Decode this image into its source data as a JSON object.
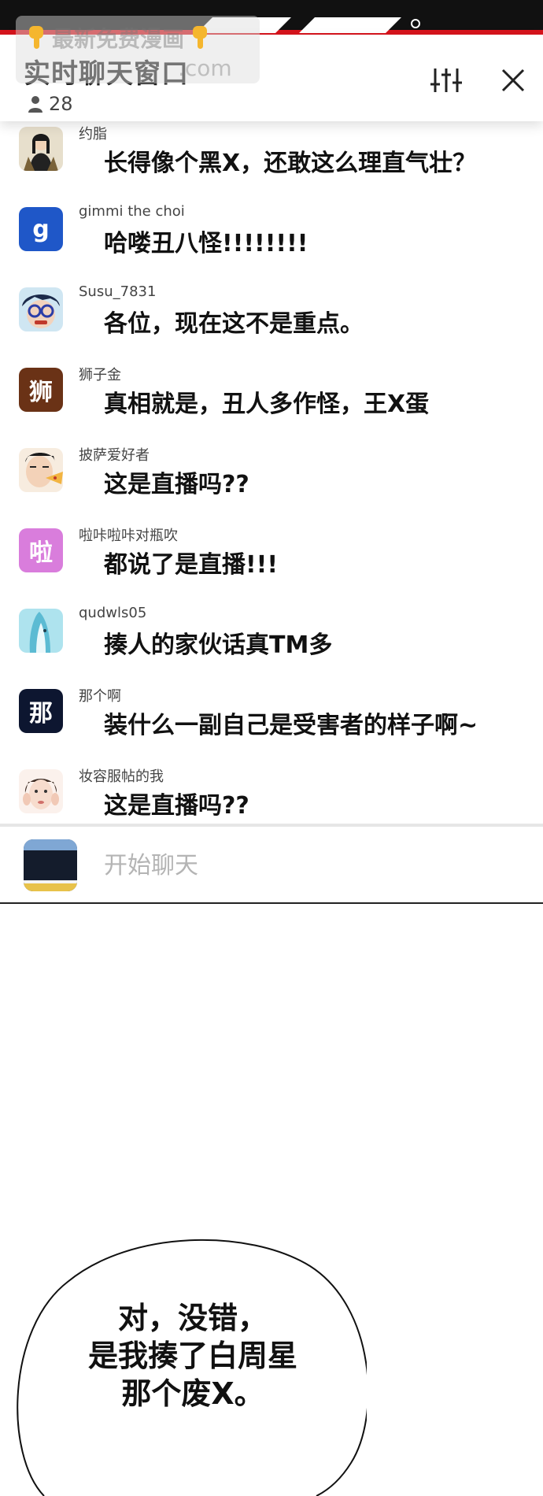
{
  "watermark": {
    "line1": "最新免费漫画",
    "line2": ".com"
  },
  "chat": {
    "title": "实时聊天窗口",
    "viewer_count": "28",
    "input_placeholder": "开始聊天"
  },
  "messages": [
    {
      "username": "约脂",
      "text": "长得像个黑X，还敢这么理直气壮？",
      "avatar_label": "",
      "avatar_color": "#8a7a5a"
    },
    {
      "username": "gimmi the choi",
      "text": "哈喽丑八怪!!!!!!!!",
      "avatar_label": "g",
      "avatar_color": "#1f57c8"
    },
    {
      "username": "Susu_7831",
      "text": "各位，现在这不是重点。",
      "avatar_label": "",
      "avatar_color": "#6fb0d8"
    },
    {
      "username": "狮子金",
      "text": "真相就是，丑人多作怪，王X蛋",
      "avatar_label": "狮",
      "avatar_color": "#6a3216"
    },
    {
      "username": "披萨爱好者",
      "text": "这是直播吗??",
      "avatar_label": "",
      "avatar_color": "#f1d7c2"
    },
    {
      "username": "啦咔啦咔对瓶吹",
      "text": "都说了是直播!!!",
      "avatar_label": "啦",
      "avatar_color": "#d97ddc"
    },
    {
      "username": "qudwls05",
      "text": "揍人的家伙话真TM多",
      "avatar_label": "",
      "avatar_color": "#9fdcea"
    },
    {
      "username": "那个啊",
      "text": "装什么一副自己是受害者的样子啊~",
      "avatar_label": "那",
      "avatar_color": "#0d1630"
    },
    {
      "username": "妆容服帖的我",
      "text": "这是直播吗??",
      "avatar_label": "",
      "avatar_color": "#f6e3da"
    }
  ],
  "bubble": {
    "lines": [
      "对，没错，",
      "是我揍了白周星",
      "那个废X。"
    ]
  }
}
